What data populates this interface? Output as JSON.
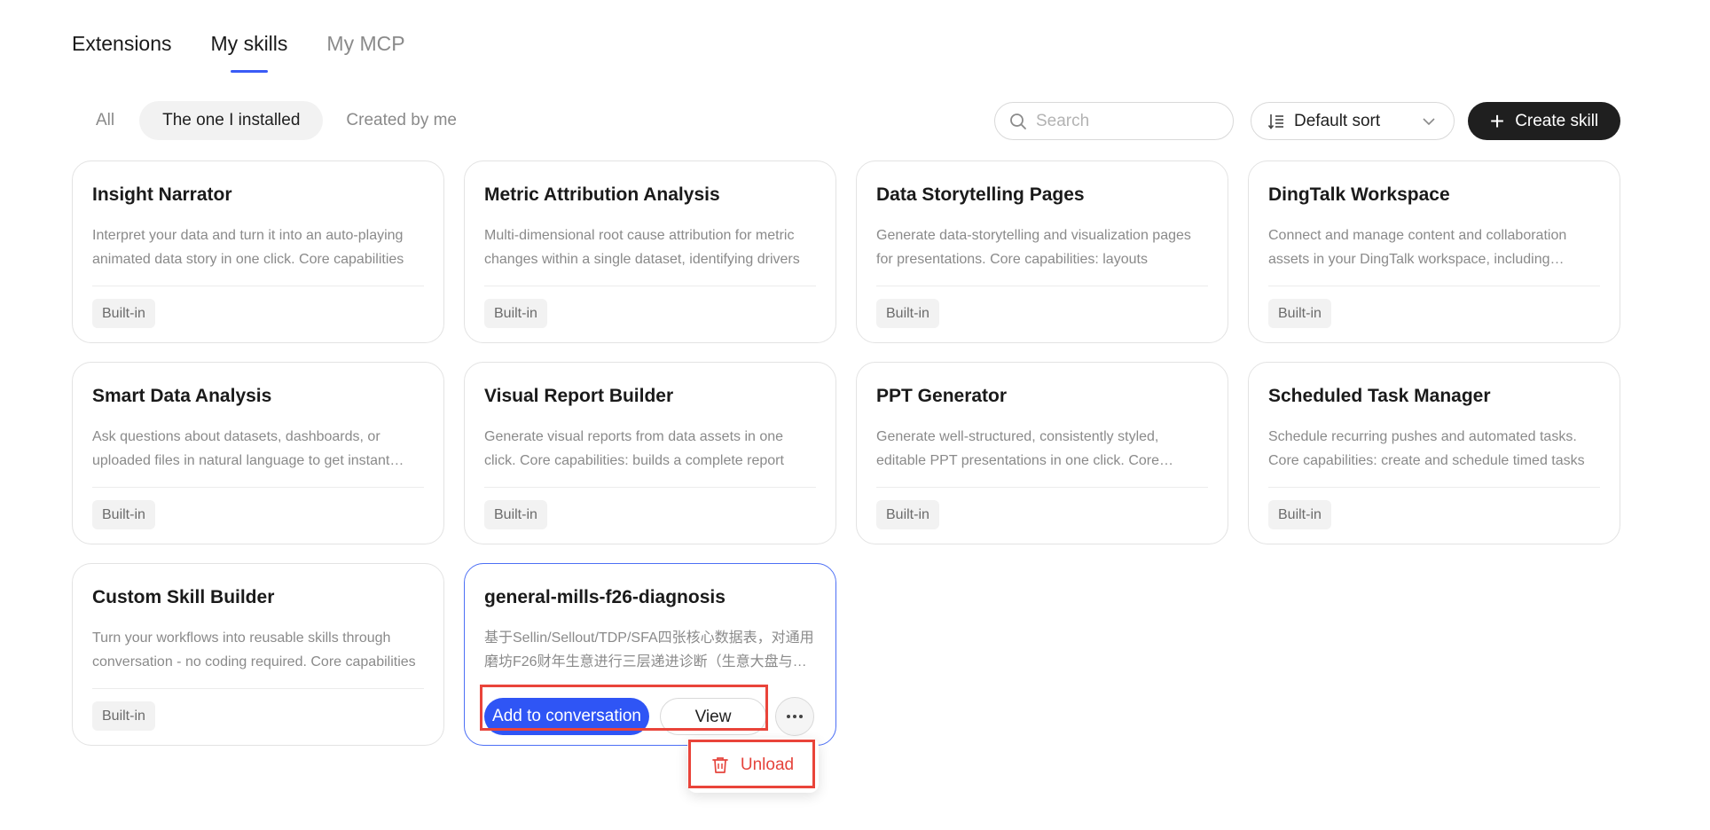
{
  "tabs": {
    "title": "Extensions",
    "my_skills": "My skills",
    "my_mcp": "My MCP"
  },
  "filters": {
    "all": "All",
    "installed": "The one I installed",
    "created": "Created by me"
  },
  "search": {
    "placeholder": "Search"
  },
  "sort": {
    "label": "Default sort"
  },
  "create": {
    "label": "Create skill"
  },
  "colors": {
    "accent": "#2f55f5",
    "danger": "#e5443c",
    "dark": "#1f1f1f"
  },
  "cards": [
    {
      "name": "Insight Narrator",
      "desc": "Interpret your data and turn it into an auto-playing animated data story in one click. Core capabilities",
      "badge": "Built-in"
    },
    {
      "name": "Metric Attribution Analysis",
      "desc": "Multi-dimensional root cause attribution for metric changes within a single dataset, identifying drivers",
      "badge": "Built-in"
    },
    {
      "name": "Data Storytelling Pages",
      "desc": "Generate data-storytelling and visualization pages for presentations. Core capabilities: layouts",
      "badge": "Built-in"
    },
    {
      "name": "DingTalk Workspace",
      "desc": "Connect and manage content and collaboration assets in your DingTalk workspace, including documents",
      "badge": "Built-in"
    },
    {
      "name": "Smart Data Analysis",
      "desc": "Ask questions about datasets, dashboards, or uploaded files in natural language to get instant answers",
      "badge": "Built-in"
    },
    {
      "name": "Visual Report Builder",
      "desc": "Generate visual reports from data assets in one click. Core capabilities: builds a complete report",
      "badge": "Built-in"
    },
    {
      "name": "PPT Generator",
      "desc": "Generate well-structured, consistently styled, editable PPT presentations in one click. Core capabilities",
      "badge": "Built-in"
    },
    {
      "name": "Scheduled Task Manager",
      "desc": "Schedule recurring pushes and automated tasks. Core capabilities: create and schedule timed tasks",
      "badge": "Built-in"
    },
    {
      "name": "Custom Skill Builder",
      "desc": "Turn your workflows into reusable skills through conversation - no coding required. Core capabilities",
      "badge": "Built-in"
    },
    {
      "name": "general-mills-f26-diagnosis",
      "desc": "基于Sellin/Sellout/TDP/SFA四张核心数据表，对通用磨坊F26财年生意进行三层递进诊断（生意大盘与结构"
    }
  ],
  "actions": {
    "add": "Add to conversation",
    "view": "View",
    "more_icon": "ellipsis-icon"
  },
  "menu": {
    "unload": "Unload"
  }
}
